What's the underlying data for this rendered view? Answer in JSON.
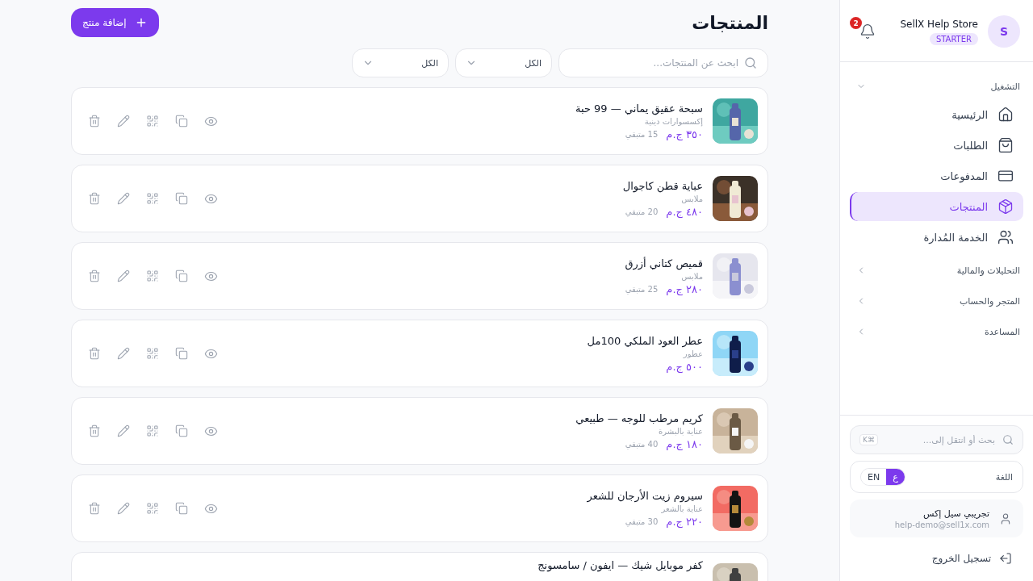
{
  "page": {
    "title": "المنتجات",
    "add_button": "إضافة منتج"
  },
  "filters": {
    "search": {
      "placeholder": "ابحث عن المنتجات..."
    },
    "selects": [
      {
        "value": "الكل"
      },
      {
        "value": "الكل"
      }
    ]
  },
  "products": [
    {
      "name": "سبحة عقيق يماني — 99 حبة",
      "category": "إكسسوارات دينية",
      "price": "٣٥٠ ج.م",
      "stock": "15 متبقي"
    },
    {
      "name": "عباية قطن كاجوال",
      "category": "ملابس",
      "price": "٤٨٠ ج.م",
      "stock": "20 متبقي"
    },
    {
      "name": "قميص كتاني أزرق",
      "category": "ملابس",
      "price": "٢٨٠ ج.م",
      "stock": "25 متبقي"
    },
    {
      "name": "عطر العود الملكي 100مل",
      "category": "عطور",
      "price": "٥٠٠ ج.م"
    },
    {
      "name": "كريم مرطب للوجه — طبيعي",
      "category": "عناية بالبشرة",
      "price": "١٨٠ ج.م",
      "stock": "40 متبقي"
    },
    {
      "name": "سيروم زيت الأرجان للشعر",
      "category": "عناية بالشعر",
      "price": "٢٢٠ ج.م",
      "stock": "30 متبقي"
    },
    {
      "name": "كفر موبايل شيك — ايفون / سامسونج"
    }
  ],
  "sidebar": {
    "store": {
      "avatar": "S",
      "name": "SellX Help Store",
      "plan": "STARTER"
    },
    "notifications": {
      "count": "2"
    },
    "sections": [
      {
        "label": "التشغيل",
        "expanded": true,
        "items": [
          {
            "label": "الرئيسية",
            "kind": "home",
            "selected": false
          },
          {
            "label": "الطلبات",
            "kind": "orders",
            "selected": false
          },
          {
            "label": "المدفوعات",
            "kind": "payments",
            "selected": false
          },
          {
            "label": "المنتجات",
            "kind": "products",
            "selected": true
          },
          {
            "label": "الخدمة المُدارة",
            "kind": "managed",
            "selected": false
          }
        ]
      },
      {
        "label": "التحليلات والمالية",
        "expanded": false
      },
      {
        "label": "المتجر والحساب",
        "expanded": false
      },
      {
        "label": "المساعدة",
        "expanded": false
      }
    ],
    "search": {
      "placeholder": "بحث أو انتقل إلى...",
      "shortcut": "K⌘"
    },
    "language": {
      "label": "اللغة",
      "options": [
        {
          "label": "ع",
          "selected": true
        },
        {
          "label": "EN",
          "selected": false
        }
      ]
    },
    "user": {
      "name": "تجريبي سيل إكس",
      "email": "help-demo@sell1x.com"
    },
    "logout": "تسجيل الخروج"
  }
}
